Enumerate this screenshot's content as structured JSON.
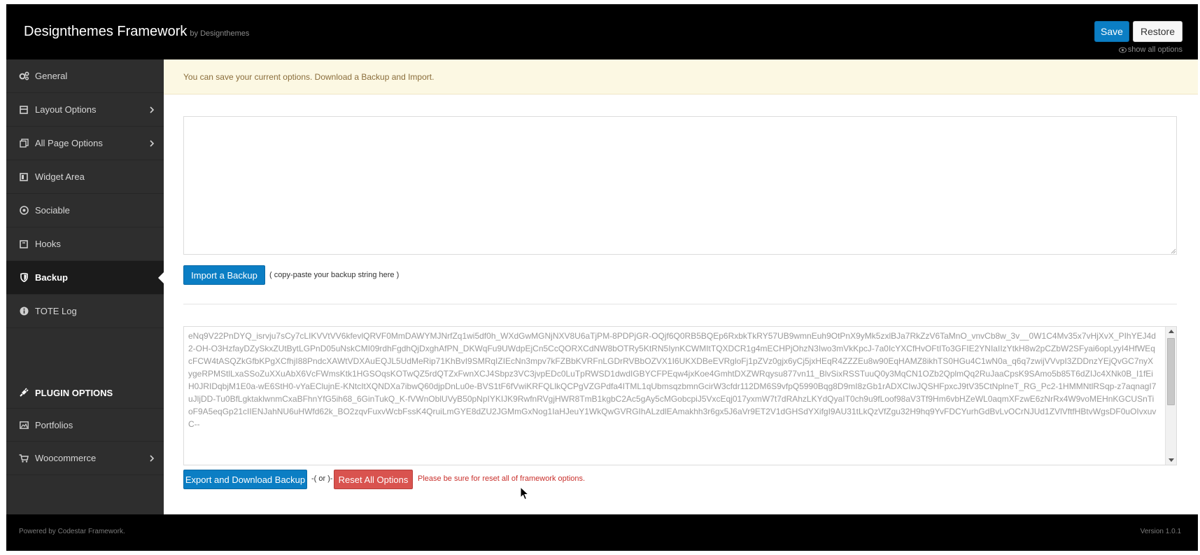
{
  "header": {
    "brand": "Designthemes Framework",
    "brand_by": "by Designthemes",
    "save_label": "Save",
    "restore_label": "Restore",
    "show_all_label": "show all options"
  },
  "sidebar": {
    "items": [
      {
        "label": "General",
        "icon": "gears-icon",
        "chevron": false
      },
      {
        "label": "Layout Options",
        "icon": "layout-icon",
        "chevron": true
      },
      {
        "label": "All Page Options",
        "icon": "pages-icon",
        "chevron": true
      },
      {
        "label": "Widget Area",
        "icon": "widget-icon",
        "chevron": false
      },
      {
        "label": "Sociable",
        "icon": "social-icon",
        "chevron": false
      },
      {
        "label": "Hooks",
        "icon": "hooks-icon",
        "chevron": false
      },
      {
        "label": "Backup",
        "icon": "shield-icon",
        "chevron": false,
        "active": true
      },
      {
        "label": "TOTE Log",
        "icon": "info-icon",
        "chevron": false
      }
    ],
    "plugin_heading": "PLUGIN OPTIONS",
    "plugin_items": [
      {
        "label": "Portfolios",
        "icon": "image-icon",
        "chevron": false
      },
      {
        "label": "Woocommerce",
        "icon": "cart-icon",
        "chevron": true
      }
    ]
  },
  "content": {
    "notice": "You can save your current options. Download a Backup and Import.",
    "import_value": "",
    "import_button": "Import a Backup",
    "import_hint": "( copy-paste your backup string here )",
    "export_value": "eNq9V22PnDYQ_isrvju7sCy7cLIKVVtVV6kfevlQRVF0MmDAWYMJNrfZq1wi5df0h_WXdGwMGNjNXV8U6aTjPM-8PDPjGR-OQjf6Q0RB5BQEp6RxbkTkRY57UB9wmnEuh9OtPnX9yMk5zxlBJa7RkZzV6TaMnO_vnvCb8w_3v__0W1C4Mv35x7vHjXvX_PIhYEJ4d2-OH-O3HzfayDZySkxZUtBytLGPnD05uNskCMI09rdhFgdhQjDxghAfPN_DKWqFu9UWdpEjCn5CcQORXCdNW8bOTRy5KtRN5IynKCWMItTQXDCR1g4mECHPjOhzN3Iwo3mVkKpcJ-7a0IcYXCfHvOFtITo3GFIE2YNIaIIzYtkH8w2pCZbW2SFyai6opLyyI4HfWEqcFCW4tASQZkGfbKPgXCfhjI88PndcXAWtVDXAuEQJL5UdMeRip71KhBvI9SMRqIZIEcNn3mpv7kFZBbKVRFnLGDrRVBbOZVX1I6UKXDBeEVRgloFj1pZVz0gjx6yCj5jxHEqR4ZZZEu8w90EqHAMZ8ikhTS0HGu4C1wN0a_q6q7zwijVVvpI3ZDDnzYEjQvGC7nyXygeRPMStlLxaSSoZuXXuAbX6VcFWmsKtk1HGSOqsKOTwQZ5rdQTZxFwnXCJ4Sbpz3VC3jvpEDc0LuTpRWSD1dwdIGBYCFPEqw4jxKoe4GmhtDXZWRqysu877vn11_BlvSixRSSTuuQ0y3MqCN1OZb2QplmQq2RuJaaCpsK9SAmo5b85T6dZIJc4XNk0B_I1fEiH0JRIDqbjM1E0a-wE6StH0-vYaEClujnE-KNtcItXQNDXa7ibwQ60djpDnLu0e-BVS1tF6fVwiKRFQLlkQCPgVZGPdfa4ITML1qUbmsqzbmnGcirW3cfdr112DM6S9vfpQ5990Bqg8D9mI8zGb1rADXCIwJQSHFpxcJ9tV35CtNplneT_RG_Pc2-1HMMNtlRSqp-z7aqnagI7uJljDD-Tu0BfLgktaklwnmCxaBFhnYfG5ih68_6GinTukQ_K-fVWnOblUVyB50pNpIYKIJK9RwfnRVgjHWR8TmB1kgbC2Ac5gAy5cMGobcpiJ5VxcEqj017yxmW7t7dRAhzLKYdQyaIT0ch9u9fLoof98aV3Tf9Hm6vbHZeWL0aqmXFzwE6zNrRx4W9voMEHnKGCUSnTioF9A5eqGp21cIIENJahNU6uHWfd62k_BO2zqvFuxvWcbFssK4QruiLmGYE8dZU2JGMmGxNog1IaHJeuY1WkQwGVRGIhALzdlEAmakhh3r6gx5J6aVr9ET2V1dGHSdYXifgI9AU31tLkQzVfZgu32H9hq9YvFDCYurhGdBvLvOCrNJUd1ZVlVftfHBtvWgsDF0uOIvxuvC--"
  },
  "export": {
    "button": "Export and Download Backup",
    "or": "-( or )-",
    "reset_button": "Reset All Options",
    "warning": "Please be sure for reset all of framework options."
  },
  "footer": {
    "left": "Powered by Codestar Framework.",
    "right": "Version 1.0.1"
  },
  "colors": {
    "primary": "#0b7ec4",
    "danger": "#d9534f",
    "sidebar": "#2e2e2e",
    "header": "#000000",
    "notice_bg": "#fcf8e3"
  }
}
